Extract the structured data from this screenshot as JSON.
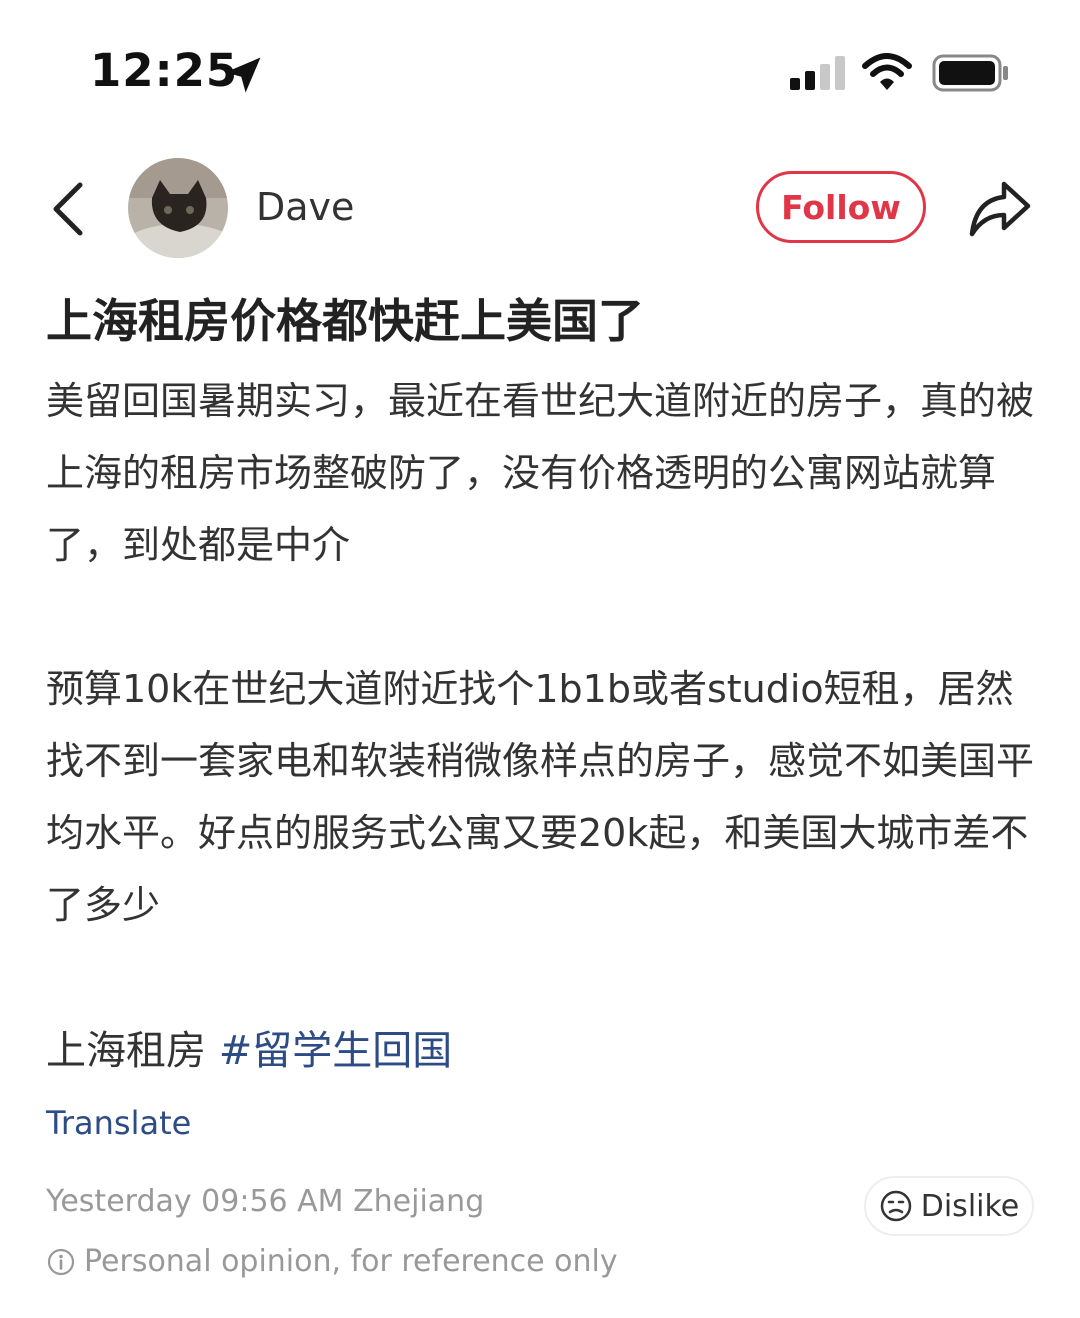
{
  "status_bar": {
    "time": "12:25",
    "icons": [
      "location-arrow-icon",
      "cellular-signal-icon",
      "wifi-icon",
      "battery-icon"
    ]
  },
  "header": {
    "back_icon": "chevron-left-icon",
    "username": "Dave",
    "follow_label": "Follow",
    "share_icon": "share-arrow-icon"
  },
  "post": {
    "title": "上海租房价格都快赶上美国了",
    "paragraphs": [
      "美留回国暑期实习，最近在看世纪大道附近的房子，真的被上海的租房市场整破防了，没有价格透明的公寓网站就算了，到处都是中介",
      "预算10k在世纪大道附近找个1b1b或者studio短租，居然找不到一套家电和软装稍微像样点的房子，感觉不如美国平均水平。好点的服务式公寓又要20k起，和美国大城市差不了多少"
    ],
    "tag_plain": "上海租房",
    "tag_hash": "#留学生回国",
    "translate_label": "Translate",
    "meta": "Yesterday 09:56 AM Zhejiang",
    "dislike_label": "Dislike",
    "disclaimer": "Personal opinion, for reference only"
  },
  "colors": {
    "accent_red": "#e03648",
    "link_blue": "#2d4b85",
    "muted_gray": "#999999"
  }
}
